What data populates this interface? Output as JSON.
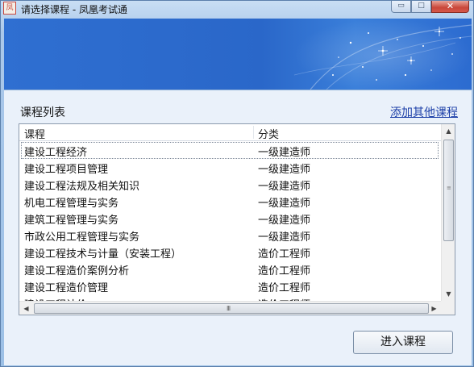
{
  "window": {
    "title": "请选择课程 - 凤凰考试通",
    "app_icon_glyph": "凤",
    "minimize_glyph": "▭",
    "maximize_glyph": "□",
    "close_glyph": "✕"
  },
  "course_list": {
    "label": "课程列表",
    "add_link": "添加其他课程",
    "columns": {
      "name": "课程",
      "category": "分类"
    },
    "rows": [
      {
        "name": "建设工程经济",
        "category": "一级建造师",
        "selected": true
      },
      {
        "name": "建设工程项目管理",
        "category": "一级建造师"
      },
      {
        "name": "建设工程法规及相关知识",
        "category": "一级建造师"
      },
      {
        "name": "机电工程管理与实务",
        "category": "一级建造师"
      },
      {
        "name": "建筑工程管理与实务",
        "category": "一级建造师"
      },
      {
        "name": "市政公用工程管理与实务",
        "category": "一级建造师"
      },
      {
        "name": "建设工程技术与计量（安装工程）",
        "category": "造价工程师"
      },
      {
        "name": "建设工程造价案例分析",
        "category": "造价工程师"
      },
      {
        "name": "建设工程造价管理",
        "category": "造价工程师"
      },
      {
        "name": "建设工程计价",
        "category": "造价工程师"
      }
    ],
    "scroll_arrows": {
      "up": "▲",
      "down": "▼",
      "left": "◀",
      "right": "▶"
    },
    "hscroll_grip": "III",
    "vscroll_grip": "≡"
  },
  "actions": {
    "enter_label": "进入课程"
  },
  "colors": {
    "banner": "#2a67c9",
    "link": "#1c3fa8",
    "client_bg": "#eaf1fa"
  }
}
